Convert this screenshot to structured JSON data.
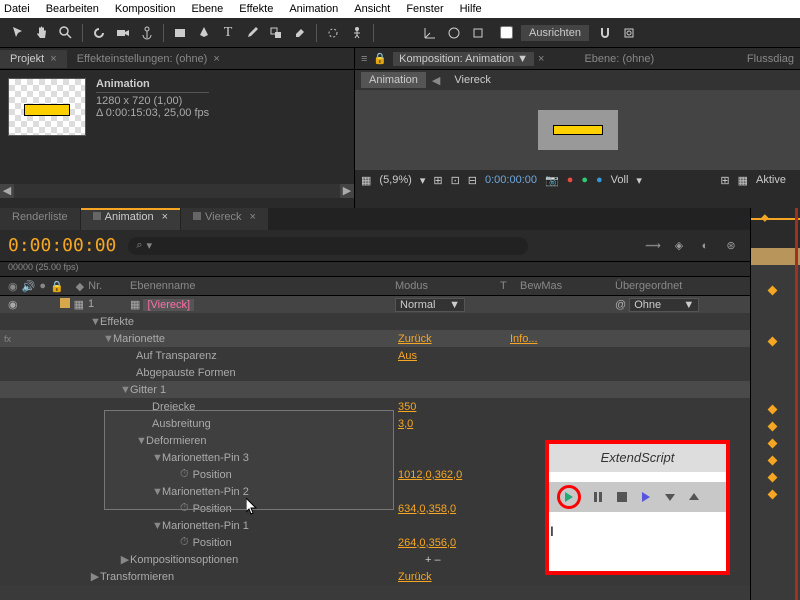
{
  "menu": [
    "Datei",
    "Bearbeiten",
    "Komposition",
    "Ebene",
    "Effekte",
    "Animation",
    "Ansicht",
    "Fenster",
    "Hilfe"
  ],
  "toolbar": {
    "align": "Ausrichten"
  },
  "project": {
    "tab1": "Projekt",
    "tab2": "Effekteinstellungen: (ohne)",
    "name": "Animation",
    "res": "1280 x 720 (1,00)",
    "dur": "Δ 0:00:15:03, 25,00 fps"
  },
  "comp": {
    "label": "Komposition: Animation",
    "layer_label": "Ebene: (ohne)",
    "flow": "Flussdiag",
    "tab_anim": "Animation",
    "tab_rect": "Viereck",
    "zoom": "(5,9%)",
    "time": "0:00:00:00",
    "quality": "Voll",
    "active": "Aktive"
  },
  "timeline": {
    "tabs": {
      "render": "Renderliste",
      "anim": "Animation",
      "rect": "Viereck"
    },
    "timecode": "0:00:00:00",
    "frames": "00000 (25.00 fps)",
    "search_ph": "",
    "cols": {
      "nr": "Nr.",
      "name": "Ebenenname",
      "mode": "Modus",
      "t": "T",
      "bew": "BewMas",
      "parent": "Übergeordnet"
    },
    "layer": {
      "num": "1",
      "name": "[Viereck]",
      "mode": "Normal",
      "parent": "Ohne"
    },
    "rows": {
      "effects": "Effekte",
      "puppet": "Marionette",
      "puppet_val": "Zurück",
      "info": "Info...",
      "transparency": "Auf Transparenz",
      "transparency_val": "Aus",
      "paused": "Abgepauste Formen",
      "grid": "Gitter 1",
      "triangles": "Dreiecke",
      "triangles_val": "350",
      "spread": "Ausbreitung",
      "spread_val": "3,0",
      "deform": "Deformieren",
      "pin3": "Marionetten-Pin 3",
      "pin2": "Marionetten-Pin 2",
      "pin1": "Marionetten-Pin 1",
      "position": "Position",
      "pos3": "1012,0,362,0",
      "pos2": "634,0,358,0",
      "pos1": "264,0,356,0",
      "compopts": "Kompositionsoptionen",
      "compopts_val": "+ –",
      "transform": "Transformieren",
      "transform_val": "Zurück"
    }
  },
  "extend": {
    "title": "ExtendScript"
  }
}
